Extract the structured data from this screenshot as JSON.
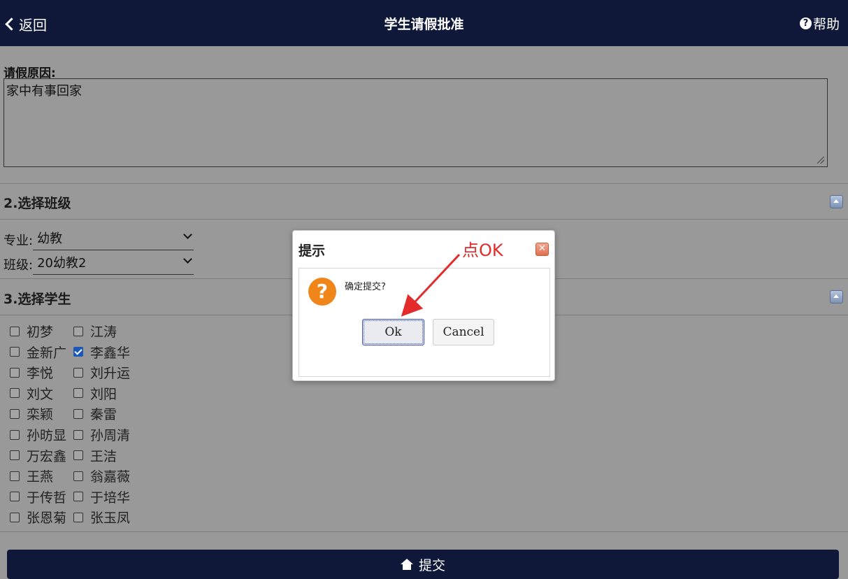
{
  "header": {
    "back_label": "返回",
    "title": "学生请假批准",
    "help_label": "帮助"
  },
  "reason": {
    "label": "请假原因:",
    "value": "家中有事回家"
  },
  "section_class": {
    "title": "2.选择班级",
    "major_label": "专业:",
    "major_value": "幼教",
    "class_label": "班级:",
    "class_value": "20幼教2"
  },
  "section_students": {
    "title": "3.选择学生",
    "students": [
      {
        "name": "初梦",
        "checked": false
      },
      {
        "name": "江涛",
        "checked": false
      },
      {
        "name": "金新广",
        "checked": false
      },
      {
        "name": "李鑫华",
        "checked": true
      },
      {
        "name": "李悦",
        "checked": false
      },
      {
        "name": "刘升运",
        "checked": false
      },
      {
        "name": "刘文",
        "checked": false
      },
      {
        "name": "刘阳",
        "checked": false
      },
      {
        "name": "栾颖",
        "checked": false
      },
      {
        "name": "秦雷",
        "checked": false
      },
      {
        "name": "孙昉显",
        "checked": false
      },
      {
        "name": "孙周清",
        "checked": false
      },
      {
        "name": "万宏鑫",
        "checked": false
      },
      {
        "name": "王洁",
        "checked": false
      },
      {
        "name": "王燕",
        "checked": false
      },
      {
        "name": "翁嘉薇",
        "checked": false
      },
      {
        "name": "于传哲",
        "checked": false
      },
      {
        "name": "于培华",
        "checked": false
      },
      {
        "name": "张恩菊",
        "checked": false
      },
      {
        "name": "张玉凤",
        "checked": false
      }
    ]
  },
  "submit": {
    "label": "提交"
  },
  "dialog": {
    "title": "提示",
    "close_glyph": "✕",
    "message": "确定提交?",
    "ok_label": "Ok",
    "cancel_label": "Cancel"
  },
  "annotation": {
    "text": "点OK",
    "color": "#e32b2b"
  },
  "colors": {
    "header_bg": "#0f1838",
    "overlay": "#999999",
    "warning_icon": "#f08519",
    "checkbox_checked": "#1b58b8"
  },
  "icons": {
    "back": "chevron-left-icon",
    "help": "question-circle-icon",
    "home": "home-icon",
    "dialog": "question-icon",
    "close": "close-icon"
  }
}
